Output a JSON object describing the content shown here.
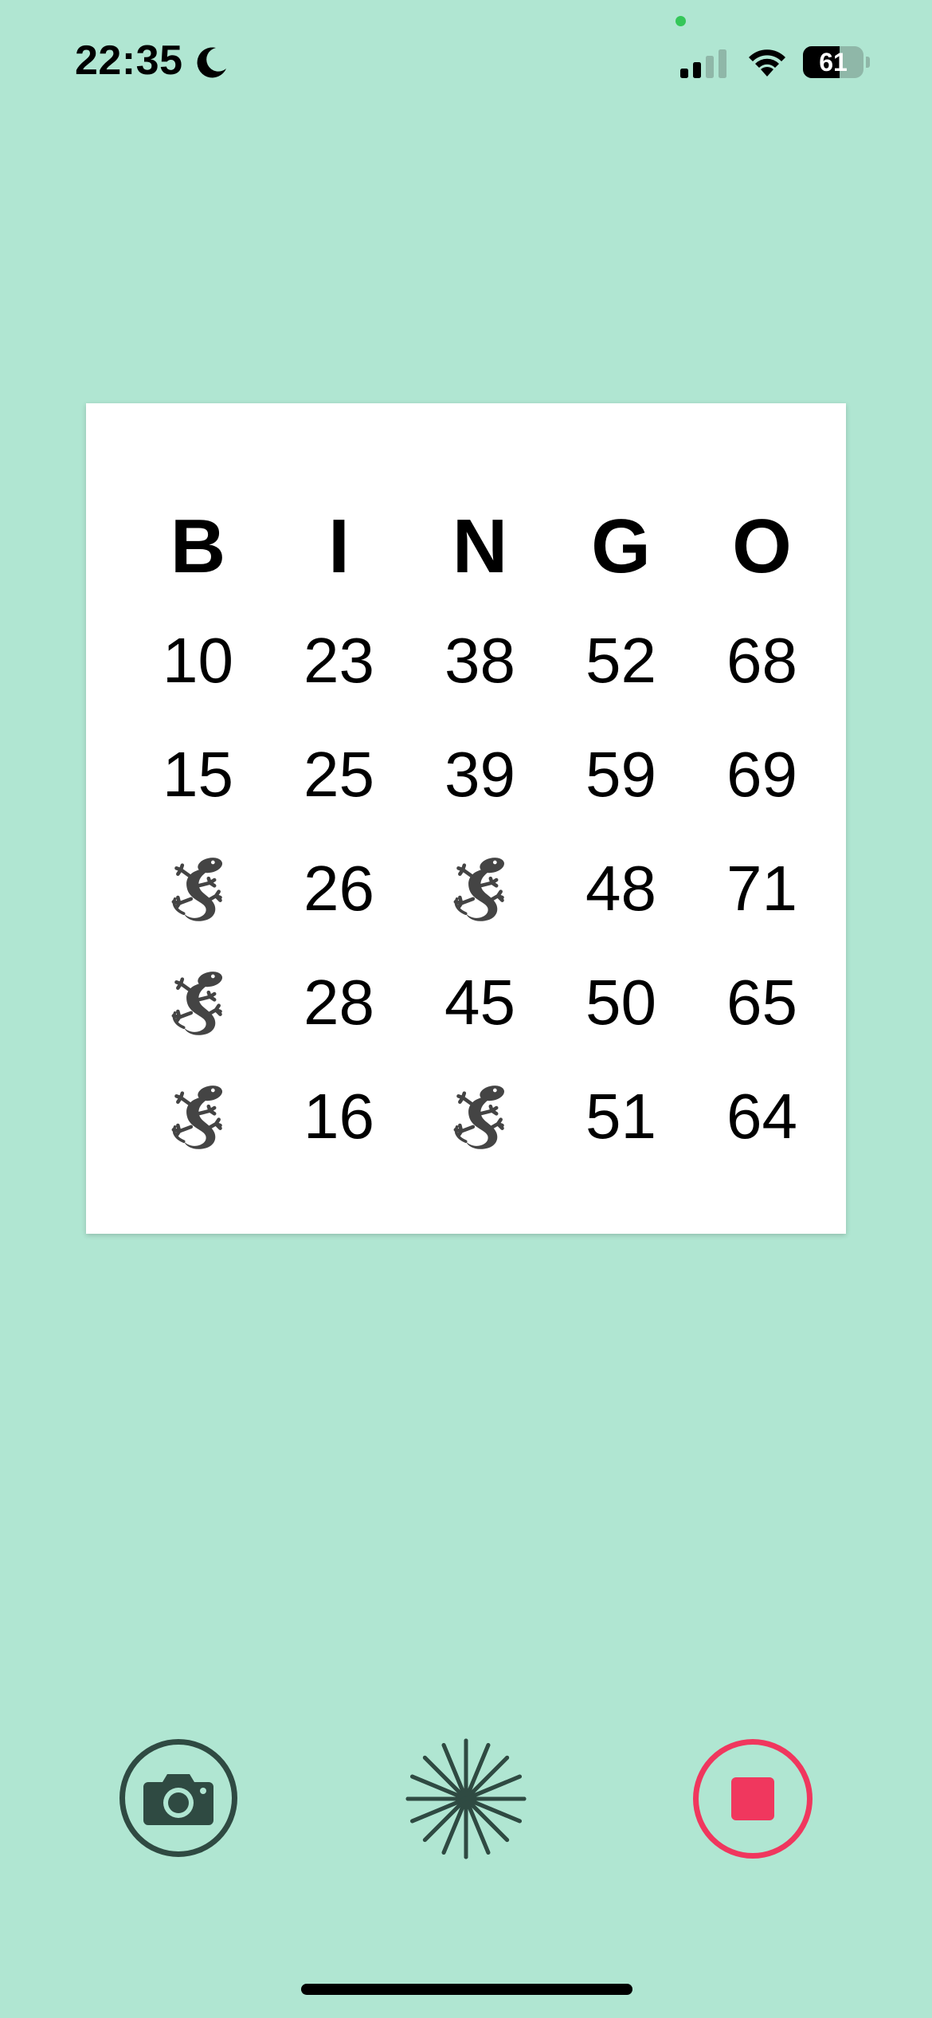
{
  "status_bar": {
    "time": "22:35",
    "battery_level": 61,
    "battery_text": "61",
    "signal_bars_active": 2,
    "signal_bars_total": 4,
    "focus_icon": "moon-icon"
  },
  "bingo": {
    "headers": [
      "B",
      "I",
      "N",
      "G",
      "O"
    ],
    "rows": [
      [
        "10",
        "23",
        "38",
        "52",
        "68"
      ],
      [
        "15",
        "25",
        "39",
        "59",
        "69"
      ],
      [
        null,
        "26",
        null,
        "48",
        "71"
      ],
      [
        null,
        "28",
        "45",
        "50",
        "65"
      ],
      [
        null,
        "16",
        null,
        "51",
        "64"
      ]
    ],
    "marked_icon": "gecko-icon"
  },
  "controls": {
    "camera_icon": "camera-icon",
    "burst_icon": "burst-icon",
    "stop_icon": "stop-icon"
  },
  "colors": {
    "background": "#b0e6d2",
    "card": "#ffffff",
    "control_dark": "#2f4a42",
    "stop_accent": "#f0375e",
    "gecko": "#444444"
  }
}
